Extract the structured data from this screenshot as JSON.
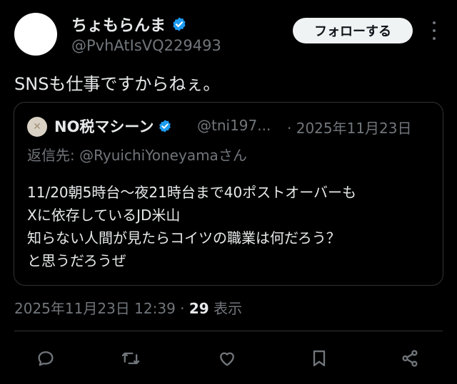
{
  "tweet": {
    "display_name": "ちょもらんま",
    "handle": "@PvhAtIsVQ229493",
    "follow_label": "フォローする",
    "text": "SNSも仕事ですからねぇ。",
    "timestamp": "2025年11月23日 12:39",
    "separator": " · ",
    "views_count": "29",
    "views_label": "表示"
  },
  "quote": {
    "display_name": "NO税マシーン",
    "handle": "@tni197...",
    "date": "· 2025年11月23日",
    "reply_prefix": "返信先: ",
    "reply_mention": "@RyuichiYoneyama",
    "reply_suffix": "さん",
    "lines": [
      "11/20朝5時台〜夜21時台まで40ポストオーバーも",
      "Xに依存しているJD米山",
      "知らない人間が見たらコイツの職業は何だろう？",
      "と思うだろうぜ"
    ]
  },
  "actions": [
    {
      "icon": "reply-icon"
    },
    {
      "icon": "retweet-icon"
    },
    {
      "icon": "like-icon"
    },
    {
      "icon": "bookmark-icon"
    },
    {
      "icon": "share-icon"
    }
  ],
  "colors": {
    "background": "#000000",
    "text": "#e7e9ea",
    "muted": "#71767b",
    "verified": "#1d9bf0",
    "border": "#2f3336"
  }
}
